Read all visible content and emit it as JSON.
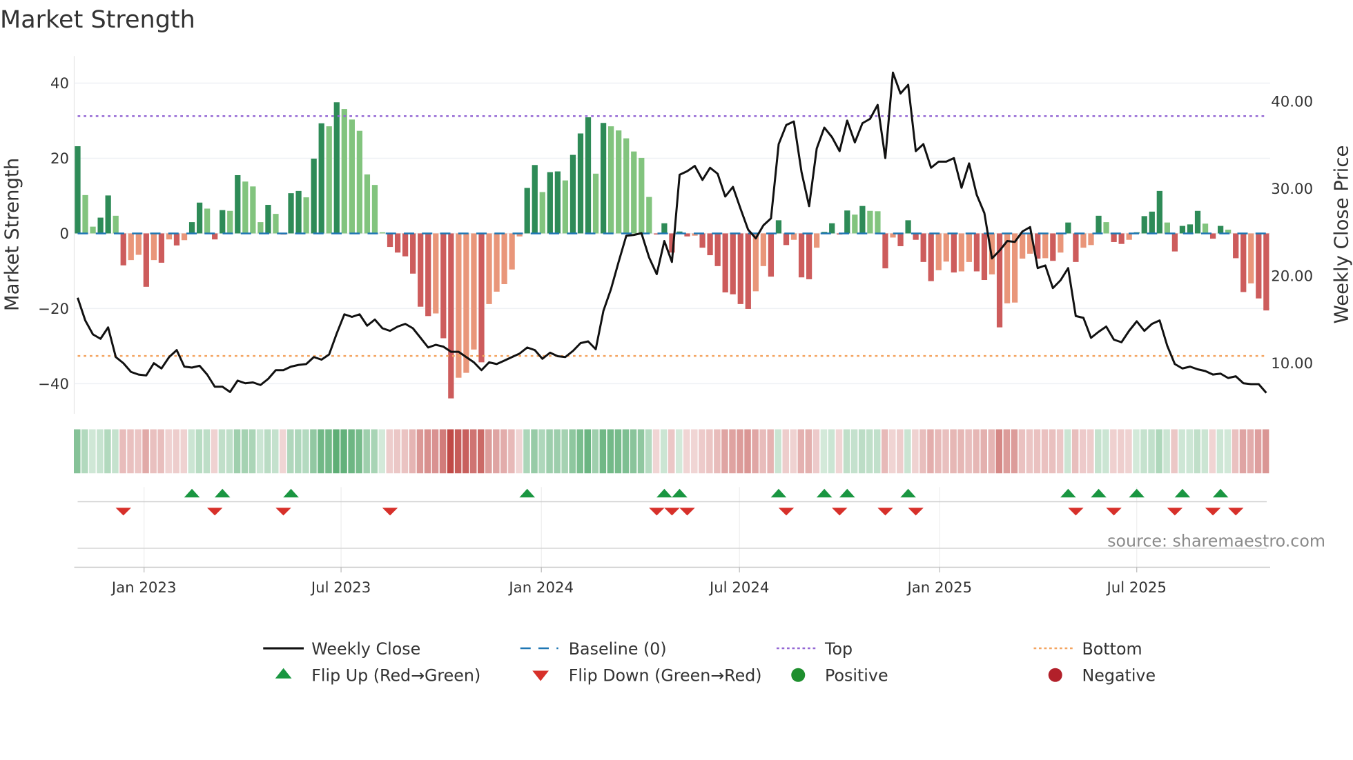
{
  "chart_data": {
    "type": "bar",
    "title": "Market Strength",
    "ylabel": "Market Strength",
    "y2label": "Weekly Close Price",
    "ylim": [
      -48,
      47.2
    ],
    "y2lim": [
      4.2,
      45.2
    ],
    "yticks": [
      40,
      20,
      0,
      -20,
      -40
    ],
    "ytick_labels": [
      "40",
      "20",
      "0",
      "−20",
      "−40"
    ],
    "y2ticks": [
      40,
      30,
      20,
      10
    ],
    "y2tick_labels": [
      "40.00",
      "30.00",
      "20.00",
      "10.00"
    ],
    "x_start": "2022-11-01",
    "x_step_days": 7,
    "xticks": [
      {
        "date": "2023-01-01",
        "label": "Jan 2023"
      },
      {
        "date": "2023-07-01",
        "label": "Jul 2023"
      },
      {
        "date": "2024-01-01",
        "label": "Jan 2024"
      },
      {
        "date": "2024-07-01",
        "label": "Jul 2024"
      },
      {
        "date": "2025-01-01",
        "label": "Jan 2025"
      },
      {
        "date": "2025-07-01",
        "label": "Jul 2025"
      }
    ],
    "top_level": 31.2,
    "bottom_level": -32.6,
    "baseline": 0,
    "grid": true,
    "strength": [
      23.2,
      10.2,
      1.8,
      4.2,
      10.1,
      4.7,
      -8.5,
      -7.1,
      -5.7,
      -14.2,
      -7.1,
      -7.8,
      -1.6,
      -3.2,
      -1.8,
      3.0,
      8.2,
      6.6,
      -1.6,
      6.2,
      6.0,
      15.5,
      13.8,
      12.5,
      3.0,
      7.6,
      5.2,
      -0.3,
      10.7,
      11.3,
      9.6,
      19.9,
      29.3,
      28.5,
      34.9,
      33.1,
      30.3,
      27.3,
      15.7,
      12.9,
      0.3,
      -3.6,
      -5.1,
      -6.1,
      -10.7,
      -19.5,
      -22.0,
      -21.3,
      -27.9,
      -43.9,
      -38.4,
      -37.1,
      -30.9,
      -34.3,
      -18.8,
      -15.5,
      -13.5,
      -9.6,
      -0.8,
      12.1,
      18.2,
      11.0,
      16.3,
      16.5,
      14.1,
      20.9,
      26.6,
      30.9,
      15.9,
      29.4,
      28.5,
      27.4,
      25.3,
      21.8,
      20.1,
      9.7,
      -0.3,
      2.7,
      -5.1,
      0.5,
      -0.8,
      -0.6,
      -3.8,
      -5.8,
      -8.7,
      -15.7,
      -16.2,
      -18.8,
      -20.1,
      -15.4,
      -8.7,
      -11.5,
      3.5,
      -3.1,
      -1.7,
      -11.7,
      -12.2,
      -3.8,
      0.4,
      2.7,
      -0.3,
      6.1,
      5.0,
      7.3,
      6.0,
      5.9,
      -9.3,
      -1.1,
      -3.4,
      3.5,
      -1.7,
      -7.6,
      -12.7,
      -9.8,
      -7.5,
      -10.4,
      -10.1,
      -7.6,
      -10.1,
      -12.4,
      -10.9,
      -25.0,
      -18.6,
      -18.4,
      -6.7,
      -5.4,
      -6.7,
      -6.6,
      -7.3,
      -5.1,
      2.9,
      -7.6,
      -3.8,
      -3.1,
      4.7,
      3.0,
      -2.3,
      -2.8,
      -1.7,
      0.3,
      4.6,
      5.8,
      11.3,
      2.9,
      -4.8,
      2.0,
      2.4,
      6.0,
      2.6,
      -1.4,
      2.0,
      1.0,
      -6.6,
      -15.6,
      -13.3,
      -17.3,
      -20.5
    ],
    "weekly_close": [
      17.5,
      14.9,
      13.3,
      12.8,
      14.1,
      10.7,
      10.0,
      9.0,
      8.7,
      8.6,
      10.0,
      9.4,
      10.7,
      11.5,
      9.6,
      9.5,
      9.7,
      8.7,
      7.3,
      7.3,
      6.7,
      8.0,
      7.7,
      7.8,
      7.5,
      8.2,
      9.2,
      9.2,
      9.6,
      9.8,
      9.9,
      10.7,
      10.4,
      11.0,
      13.4,
      15.6,
      15.3,
      15.6,
      14.3,
      15.0,
      14.0,
      13.7,
      14.2,
      14.5,
      14.0,
      12.9,
      11.8,
      12.1,
      11.9,
      11.3,
      11.3,
      10.7,
      10.1,
      9.2,
      10.1,
      9.9,
      10.3,
      10.7,
      11.1,
      11.8,
      11.5,
      10.5,
      11.2,
      10.8,
      10.7,
      11.4,
      12.3,
      12.5,
      11.6,
      16.0,
      18.5,
      21.6,
      24.6,
      24.7,
      24.9,
      22.1,
      20.2,
      24.0,
      21.6,
      31.6,
      32.0,
      32.6,
      31.0,
      32.4,
      31.7,
      29.1,
      30.2,
      27.7,
      25.3,
      24.3,
      25.8,
      26.6,
      35.1,
      37.3,
      37.7,
      31.9,
      28.0,
      34.6,
      37.0,
      35.9,
      34.3,
      37.8,
      35.3,
      37.5,
      38.0,
      39.6,
      33.5,
      43.3,
      40.9,
      41.9,
      34.3,
      35.1,
      32.4,
      33.1,
      33.1,
      33.5,
      30.1,
      32.9,
      29.3,
      27.2,
      22.0,
      22.9,
      24.0,
      23.9,
      25.1,
      25.6,
      20.9,
      21.2,
      18.6,
      19.5,
      20.9,
      15.4,
      15.2,
      12.9,
      13.6,
      14.2,
      12.7,
      12.4,
      13.7,
      14.8,
      13.7,
      14.5,
      14.9,
      12.0,
      9.9,
      9.4,
      9.6,
      9.3,
      9.1,
      8.7,
      8.8,
      8.3,
      8.5,
      7.7,
      7.6,
      7.6,
      6.6
    ],
    "legend": {
      "placement": "bottom",
      "entries": [
        {
          "label": "Weekly Close",
          "kind": "line",
          "color": "#111111"
        },
        {
          "label": "Baseline (0)",
          "kind": "dashed",
          "color": "#1f77b4"
        },
        {
          "label": "Top",
          "kind": "dotted",
          "color": "#9467d4"
        },
        {
          "label": "Bottom",
          "kind": "dotted",
          "color": "#f4a460"
        },
        {
          "label": "Flip Up (Red→Green)",
          "kind": "triangle-up",
          "color": "#1a9641"
        },
        {
          "label": "Flip Down (Green→Red)",
          "kind": "triangle-down",
          "color": "#d7302a"
        },
        {
          "label": "Positive",
          "kind": "circle",
          "color": "#1e8f2e"
        },
        {
          "label": "Negative",
          "kind": "circle",
          "color": "#b2202a"
        }
      ]
    },
    "annotation": "source: sharemaestro.com",
    "colors": {
      "pos_strong": "#2e8b57",
      "pos_weak": "#82c47e",
      "neg_strong": "#cd5c5c",
      "neg_weak": "#e9967a",
      "heat_pos": "#3f9f5c",
      "heat_neg": "#c04a47",
      "line": "#111111",
      "baseline": "#1f77b4",
      "top": "#9467d4",
      "bottom": "#f4a460",
      "flip_up": "#1a9641",
      "flip_down": "#d7302a"
    }
  }
}
